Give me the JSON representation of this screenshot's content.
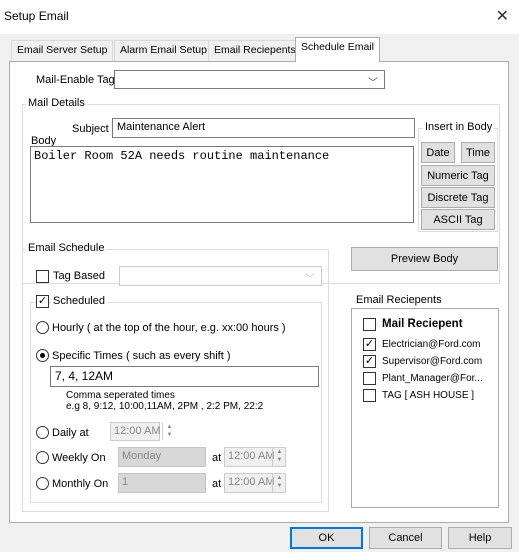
{
  "window": {
    "title": "Setup Email"
  },
  "tabs": [
    {
      "label": "Email Server Setup"
    },
    {
      "label": "Alarm Email Setup"
    },
    {
      "label": "Email Reciepents"
    },
    {
      "label": "Schedule Email"
    }
  ],
  "mail_enable_tag": {
    "label": "Mail-Enable Tag",
    "value": ""
  },
  "mail_details": {
    "title": "Mail Details",
    "subject_label": "Subject",
    "subject_value": "Maintenance Alert",
    "body_label": "Body",
    "body_value": "Boiler Room 52A needs routine maintenance"
  },
  "insert_in_body": {
    "title": "Insert in Body",
    "date": "Date",
    "time": "Time",
    "numeric_tag": "Numeric Tag",
    "discrete_tag": "Discrete Tag",
    "ascii_tag": "ASCII Tag"
  },
  "email_schedule": {
    "title": "Email Schedule",
    "tag_based": "Tag Based",
    "scheduled": "Scheduled",
    "hourly": "Hourly ( at the top of the hour, e.g. xx:00 hours )",
    "specific_times": "Specific Times ( such as every shift )",
    "specific_times_value": "7, 4, 12AM",
    "hint_line1": "Comma seperated times",
    "hint_line2": "e.g 8, 9:12, 10:00,11AM, 2PM , 2:2 PM, 22:2",
    "daily_label": "Daily at",
    "daily_time": "12:00 AM",
    "weekly_label": "Weekly On",
    "weekly_day": "Monday",
    "weekly_at": "at",
    "weekly_time": "12:00 AM",
    "monthly_label": "Monthly On",
    "monthly_day": "1",
    "monthly_at": "at",
    "monthly_time": "12:00 AM"
  },
  "preview_body": "Preview Body",
  "recipients": {
    "title": "Email Reciepents",
    "header": "Mail Reciepent",
    "items": [
      {
        "label": "Electrician@Ford.com",
        "checked": true
      },
      {
        "label": "Supervisor@Ford.com",
        "checked": true
      },
      {
        "label": "Plant_Manager@For...",
        "checked": false
      },
      {
        "label": "TAG [ ASH HOUSE ]",
        "checked": false
      }
    ]
  },
  "buttons": {
    "ok": "OK",
    "cancel": "Cancel",
    "help": "Help"
  }
}
